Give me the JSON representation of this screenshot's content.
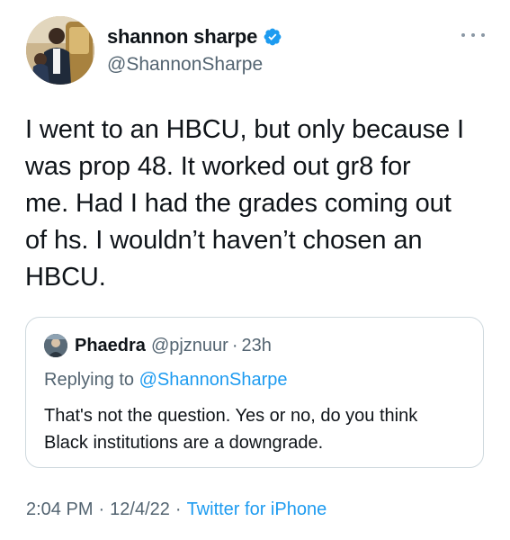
{
  "author": {
    "display_name": "shannon sharpe",
    "handle": "@ShannonSharpe",
    "verified": true,
    "verified_icon": "verified-badge-icon",
    "more_icon": "more-dots-icon"
  },
  "tweet": {
    "lines": [
      "I went to an HBCU, but only because I",
      "was prop 48. It worked out gr8 for",
      "me. Had I had the grades coming out",
      "of hs. I wouldn’t haven’t chosen an",
      "HBCU."
    ]
  },
  "quoted": {
    "display_name": "Phaedra",
    "handle": "@pjznuur",
    "separator": "·",
    "time": "23h",
    "replying_prefix": "Replying to ",
    "replying_to": "@ShannonSharpe",
    "text_lines": [
      "That's not the question. Yes or no, do you think",
      "Black institutions are a downgrade."
    ]
  },
  "meta": {
    "time": "2:04 PM",
    "separator": "·",
    "date": "12/4/22",
    "source": "Twitter for iPhone"
  },
  "colors": {
    "accent": "#1d9bf0",
    "secondary_text": "#536471",
    "primary_text": "#0f1419",
    "border": "#cfd9de"
  }
}
